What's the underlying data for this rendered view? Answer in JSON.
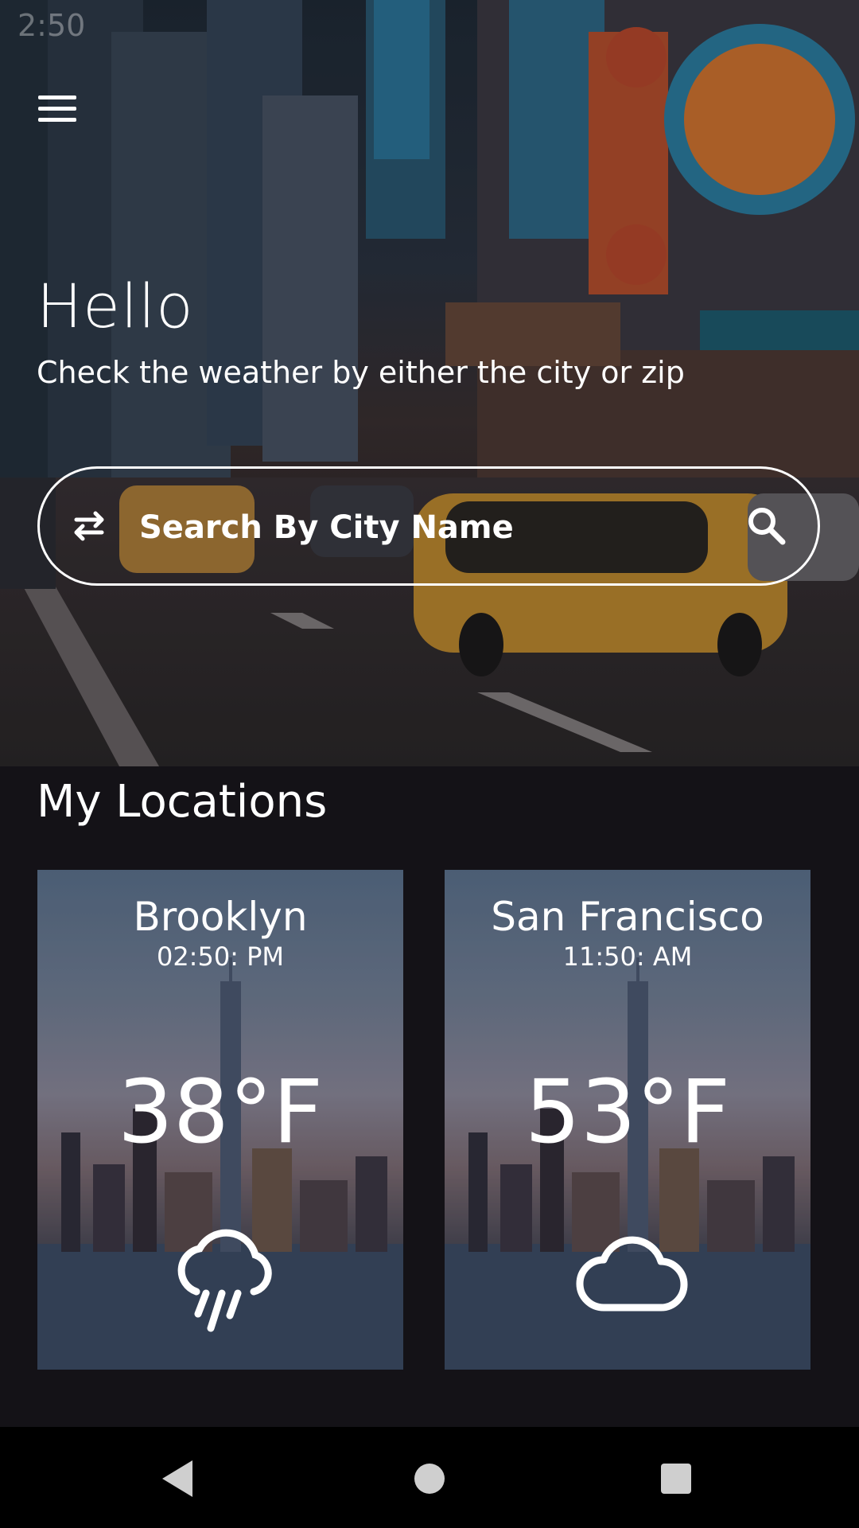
{
  "status_bar": {
    "time": "2:50"
  },
  "header": {
    "greeting": "Hello",
    "subtitle": "Check the weather by either the city or zip"
  },
  "search": {
    "placeholder": "Search By City Name",
    "value": ""
  },
  "icons": {
    "menu": "hamburger-menu-icon",
    "swap": "swap-arrows-icon",
    "search": "magnifier-icon",
    "rain": "cloud-rain-icon",
    "cloud": "cloud-icon",
    "back": "triangle-back-icon",
    "home": "circle-home-icon",
    "recent": "square-recent-icon"
  },
  "locations": {
    "title": "My Locations",
    "items": [
      {
        "city": "Brooklyn",
        "time": "02:50: PM",
        "temperature": "38°F",
        "condition_icon": "cloud-rain-icon"
      },
      {
        "city": "San Francisco",
        "time": "11:50: AM",
        "temperature": "53°F",
        "condition_icon": "cloud-icon"
      }
    ]
  },
  "colors": {
    "background": "#141217",
    "text": "#ffffff",
    "nav_bar": "#000000",
    "nav_icons": "#cfcfcf"
  }
}
